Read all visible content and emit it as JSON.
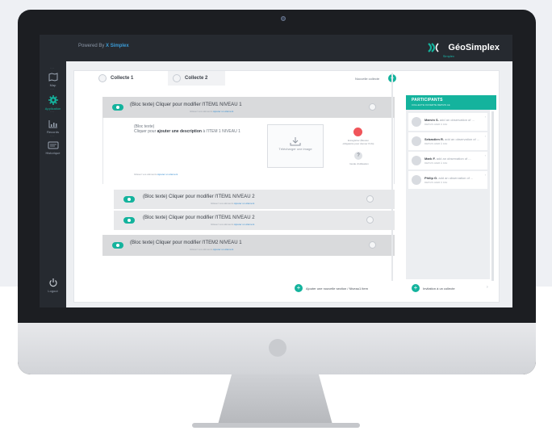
{
  "colors": {
    "accent": "#14b39d",
    "record": "#f0555a",
    "sidebar": "#262a30"
  },
  "topbar": {
    "powered_by": "Powered By",
    "powered_brand": "X Simplex",
    "brand_name": "GéoSimplex",
    "brand_sub": "Simplex"
  },
  "sidebar": {
    "items": [
      {
        "label": "Map",
        "icon": "map-icon"
      },
      {
        "label": "Application",
        "icon": "gear-icon"
      },
      {
        "label": "Records",
        "icon": "chart-icon"
      },
      {
        "label": "Historique",
        "icon": "history-icon"
      }
    ],
    "logout": "Logout"
  },
  "tabs": [
    {
      "label": "Collecte 1"
    },
    {
      "label": "Collecte 2"
    }
  ],
  "new_collect": "Nouvelle collecte",
  "sections": [
    {
      "title": "(Bloc texte) Cliquer pour modifier l'ITEM1 NIVEAU 1",
      "sub": "Glissez vos éléments",
      "sub_link": "Ajouter un élément"
    },
    {
      "title": "(Bloc texte) Cliquer pour modifier l'ITEM1 NIVEAU 2",
      "sub": "Glissez vos éléments",
      "sub_link": "Ajouter un élément"
    },
    {
      "title": "(Bloc texte) Cliquer pour modifier l'ITEM1 NIVEAU 2",
      "sub": "Glissez vos éléments",
      "sub_link": "Ajouter un élément"
    },
    {
      "title": "(Bloc texte) Cliquer pour modifier l'ITEM2 NIVEAU 1",
      "sub": "Glissez vos éléments",
      "sub_link": "Ajouter un élément"
    }
  ],
  "expanded": {
    "desc_line1": "(Bloc texte)",
    "desc_line2_a": "Cliquer pour ",
    "desc_line2_b": "ajouter une description",
    "desc_line2_c": " à l'ITEM 1 NIVEAU 1",
    "upload_label": "Télécharger une image",
    "record_label": "Enregistrer (Bouton obligatoire pour donner l'info)",
    "help_label": "Guide d'utilisation",
    "footer": "Glissez vos éléments",
    "footer_link": "Ajouter un élément"
  },
  "add_section": "Ajouter une nouvelle section / Niveau1 item",
  "participants": {
    "title": "PARTICIPANTS",
    "subtitle": "COLLECTE OUVERTE DEPUIS LE",
    "items": [
      {
        "name": "Marvin S.",
        "action": "add an observation of ...",
        "time": "DEPUIS HIER À 10H"
      },
      {
        "name": "Sebastien R.",
        "action": "add an observation of ...",
        "time": "DEPUIS HIER À 10H"
      },
      {
        "name": "Mark F.",
        "action": "add an observation of ...",
        "time": "DEPUIS HIER À 10H"
      },
      {
        "name": "Philip G.",
        "action": "add an observation of ...",
        "time": "DEPUIS HIER À 10H"
      }
    ],
    "invite": "Invitation à un collecte"
  }
}
